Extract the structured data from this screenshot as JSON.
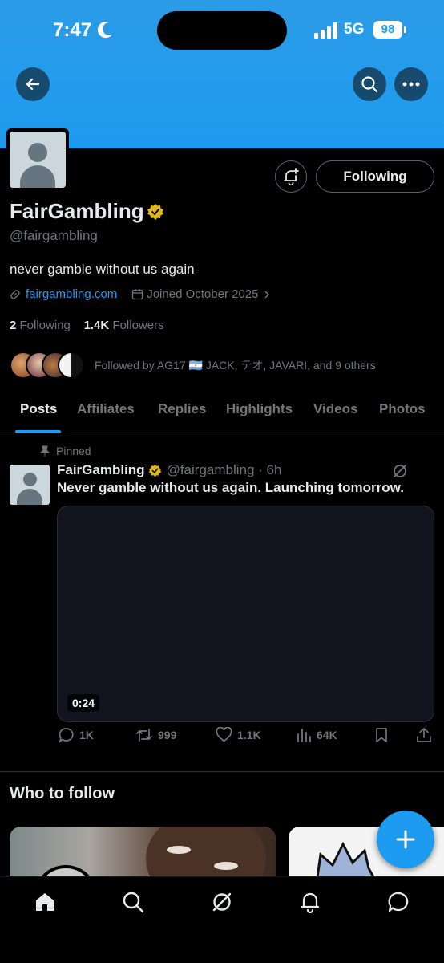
{
  "status_bar": {
    "time": "7:47",
    "network": "5G",
    "battery": "98"
  },
  "profile": {
    "name": "FairGambling",
    "handle": "@fairgambling",
    "bio": "never gamble without us again",
    "website": "fairgambling.com",
    "joined": "Joined October 2025",
    "following_count": "2",
    "following_label": "Following",
    "followers_count": "1.4K",
    "followers_label": "Followers",
    "followed_by": "Followed by AG17 🇦🇷 JACK, テオ, JAVARI, and 9 others",
    "follow_button": "Following"
  },
  "tabs": [
    {
      "label": "Posts",
      "active": true
    },
    {
      "label": "Affiliates"
    },
    {
      "label": "Replies"
    },
    {
      "label": "Highlights"
    },
    {
      "label": "Videos"
    },
    {
      "label": "Photos"
    }
  ],
  "pinned_post": {
    "pinned_label": "Pinned",
    "author": "FairGambling",
    "handle_time": "@fairgambling · 6h",
    "text": "Never gamble without us again. Launching tomorrow.",
    "duration": "0:24",
    "replies": "1K",
    "reposts": "999",
    "likes": "1.1K",
    "views": "64K"
  },
  "who_to_follow": {
    "title": "Who to follow"
  },
  "colors": {
    "accent": "#1d9bf0",
    "verified": "#f4b400",
    "background": "#000000"
  }
}
